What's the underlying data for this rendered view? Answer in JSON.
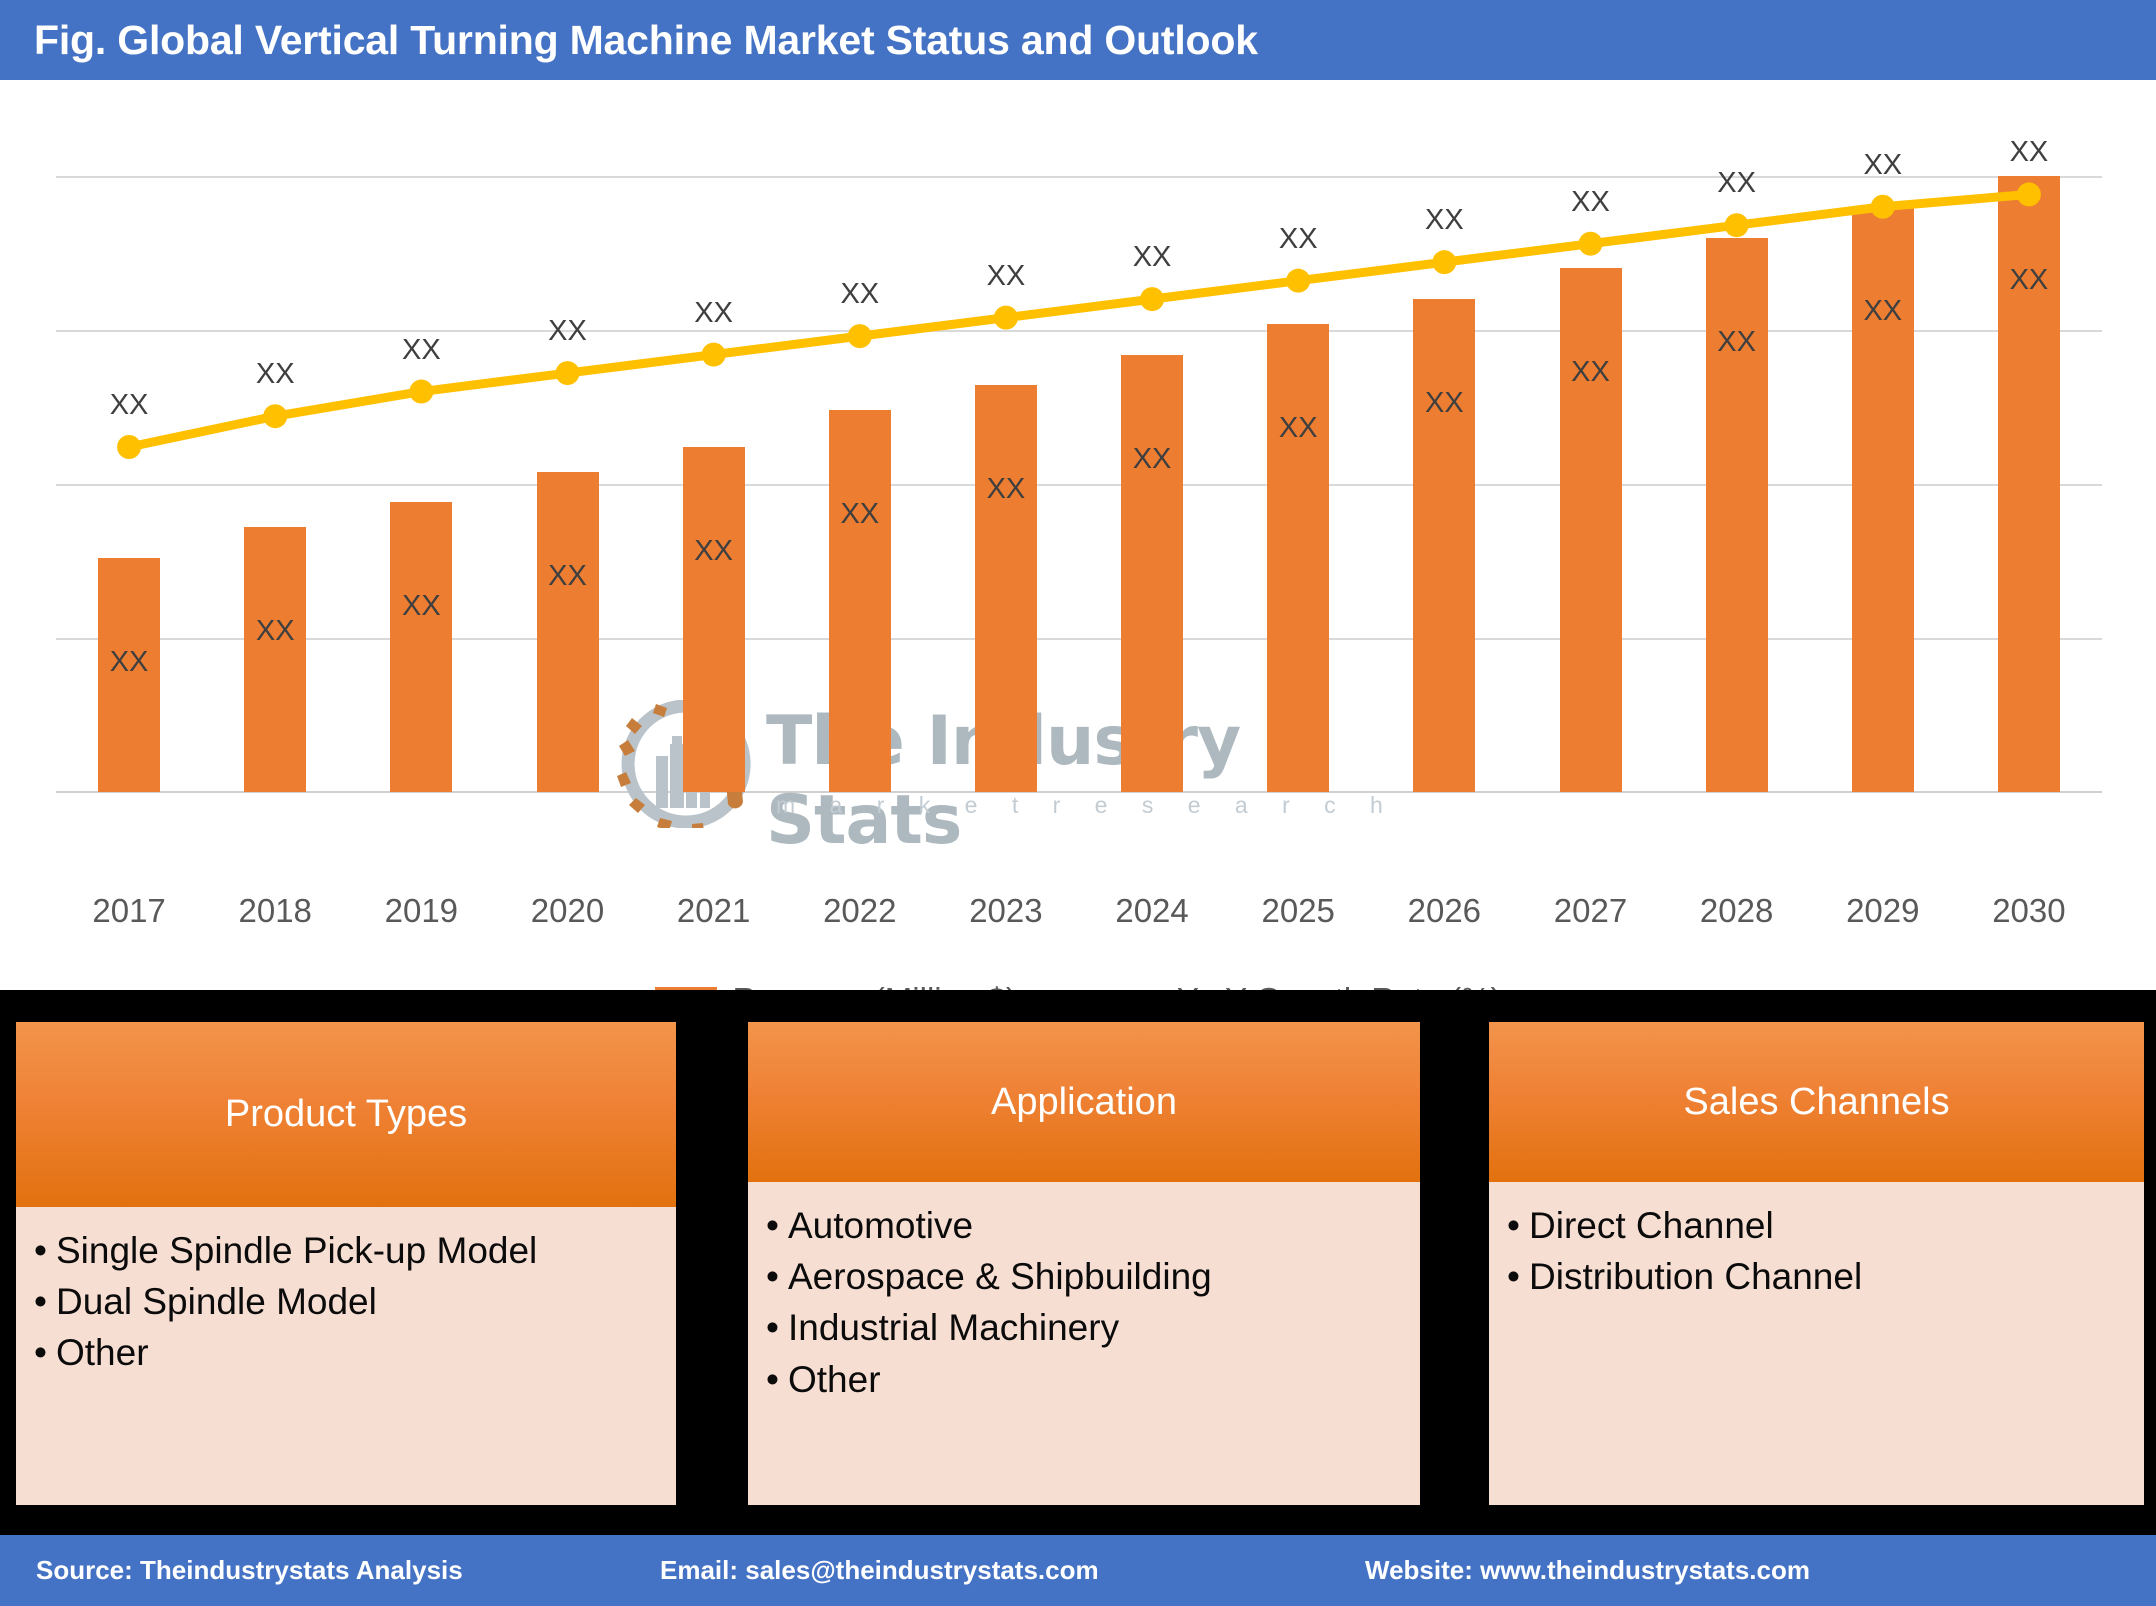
{
  "header": {
    "title": "Fig. Global Vertical Turning Machine Market Status and Outlook"
  },
  "watermark": {
    "brand": "The Industry Stats",
    "tagline": "m a r k e t   r e s e a r c h",
    "logo_icon": "gear-factory-wrench-icon"
  },
  "chart_data": {
    "type": "bar",
    "title": "Global Vertical Turning Machine Market Status and Outlook",
    "xlabel": "",
    "ylabel": "",
    "grid": true,
    "legend_position": "bottom",
    "categories": [
      "2017",
      "2018",
      "2019",
      "2020",
      "2021",
      "2022",
      "2023",
      "2024",
      "2025",
      "2026",
      "2027",
      "2028",
      "2029",
      "2030"
    ],
    "bar_labels": [
      "XX",
      "XX",
      "XX",
      "XX",
      "XX",
      "XX",
      "XX",
      "XX",
      "XX",
      "XX",
      "XX",
      "XX",
      "XX",
      "XX"
    ],
    "line_labels": [
      "XX",
      "XX",
      "XX",
      "XX",
      "XX",
      "XX",
      "XX",
      "XX",
      "XX",
      "XX",
      "XX",
      "XX",
      "XX",
      "XX"
    ],
    "series": [
      {
        "name": "Revenue (Million $)",
        "type": "bar",
        "color": "#ED7D31",
        "values": [
          38,
          43,
          47,
          52,
          56,
          62,
          66,
          71,
          76,
          80,
          85,
          90,
          95,
          100
        ]
      },
      {
        "name": "Y-oY Growth Rate (%)",
        "type": "line",
        "color": "#FFC000",
        "values": [
          56,
          61,
          65,
          68,
          71,
          74,
          77,
          80,
          83,
          86,
          89,
          92,
          95,
          97
        ]
      }
    ],
    "ylim": [
      0,
      112
    ],
    "gridlines": [
      25,
      50,
      75,
      100
    ]
  },
  "legend": {
    "items": [
      {
        "label": "Revenue (Million $)",
        "marker": "square",
        "color": "#ED7D31"
      },
      {
        "label": "Y-oY Growth Rate (%)",
        "marker": "line-dot",
        "color": "#FFC000"
      }
    ]
  },
  "panels": [
    {
      "title": "Product Types",
      "items": [
        "Single Spindle Pick-up Model",
        "Dual Spindle Model",
        "Other"
      ]
    },
    {
      "title": "Application",
      "items": [
        "Automotive",
        "Aerospace & Shipbuilding",
        "Industrial Machinery",
        "Other"
      ]
    },
    {
      "title": "Sales Channels",
      "items": [
        "Direct Channel",
        "Distribution Channel"
      ]
    }
  ],
  "footer": {
    "source": "Source: Theindustrystats Analysis",
    "email": "Email: sales@theindustrystats.com",
    "website": "Website: www.theindustrystats.com"
  },
  "colors": {
    "header_blue": "#4472C4",
    "bar_orange": "#ED7D31",
    "line_yellow": "#FFC000",
    "panel_body": "#F7DED3",
    "panel_head_top": "#F2944B",
    "panel_head_bottom": "#E2710E",
    "background_black": "#000000"
  }
}
